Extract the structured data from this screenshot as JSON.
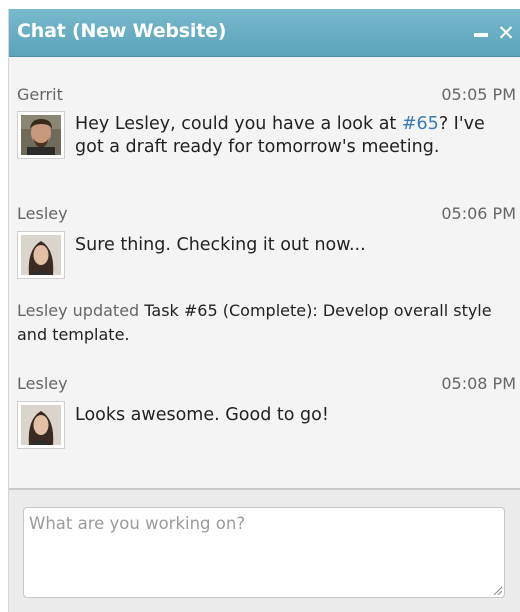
{
  "window": {
    "title": "Chat (New Website)",
    "minimize_icon": "minimize-icon",
    "close_icon": "close-icon",
    "close_glyph": "✕"
  },
  "messages": [
    {
      "author": "Gerrit",
      "time": "05:05 PM",
      "avatar": "avatar-gerrit",
      "text_before": "Hey Lesley, could you have a look at ",
      "link": "#65",
      "text_after": "? I've got a draft ready for tomorrow's meeting."
    },
    {
      "author": "Lesley",
      "time": "05:06 PM",
      "avatar": "avatar-lesley",
      "text": "Sure thing. Checking it out now..."
    },
    {
      "author": "Lesley",
      "time": "05:08 PM",
      "avatar": "avatar-lesley",
      "text": "Looks awesome. Good to go!"
    }
  ],
  "activity": {
    "actor": "Lesley updated",
    "text": " Task #65 (Complete): Develop overall style and template."
  },
  "composer": {
    "placeholder": "What are you working on?",
    "value": ""
  },
  "colors": {
    "titlebar": "#6aaec3",
    "link": "#3b7bb0",
    "muted": "#666666"
  }
}
